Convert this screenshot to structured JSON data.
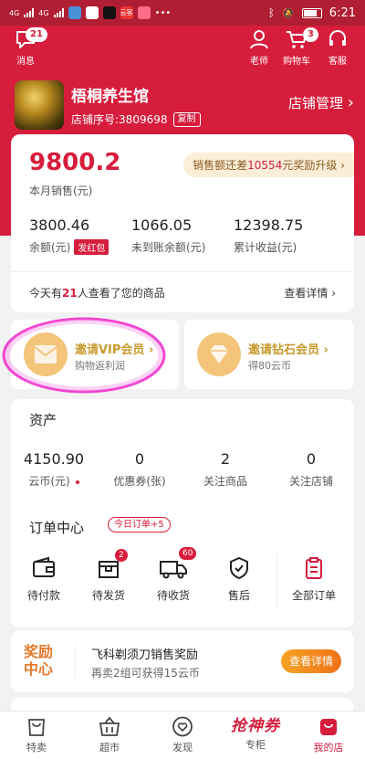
{
  "status_bar": {
    "network_1": "4G",
    "network_2": "4G",
    "app_badge": "云客",
    "time": "6:21"
  },
  "header": {
    "messages": {
      "label": "消息",
      "badge": "21"
    },
    "teacher": {
      "label": "老师"
    },
    "cart": {
      "label": "购物车",
      "badge": "3"
    },
    "service": {
      "label": "客服"
    },
    "store": {
      "name": "梧桐养生馆",
      "number": "店铺序号:3809698",
      "copy_label": "复制"
    },
    "manage_label": "店铺管理",
    "manage_chevron": "›"
  },
  "sales": {
    "monthly_value": "9800.2",
    "monthly_label": "本月销售(元)",
    "upgrade_prefix": "销售额还差",
    "upgrade_amount": "10554",
    "upgrade_suffix": "元奖励升级",
    "upgrade_chevron": "›",
    "stats": [
      {
        "value": "3800.46",
        "label": "余额(元)",
        "tag": "发红包"
      },
      {
        "value": "1066.05",
        "label": "未到账余额(元)"
      },
      {
        "value": "12398.75",
        "label": "累计收益(元)"
      }
    ],
    "viewed_prefix": "今天有",
    "viewed_count": "21",
    "viewed_suffix": "人查看了您的商品",
    "detail_label": "查看详情",
    "detail_chevron": "›"
  },
  "invites": {
    "vip": {
      "title": "邀请VIP会员",
      "subtitle": "购物返利润",
      "chevron": "›"
    },
    "diamond": {
      "title": "邀请钻石会员",
      "subtitle": "得80云币",
      "chevron": "›"
    }
  },
  "assets": {
    "title": "资产",
    "items": [
      {
        "value": "4150.90",
        "label": "云币(元)"
      },
      {
        "value": "0",
        "label": "优惠券(张)"
      },
      {
        "value": "2",
        "label": "关注商品"
      },
      {
        "value": "0",
        "label": "关注店铺"
      }
    ]
  },
  "orders": {
    "title": "订单中心",
    "today_badge": "今日订单+5",
    "items": [
      {
        "label": "待付款",
        "icon": "wallet-icon"
      },
      {
        "label": "待发货",
        "icon": "package-icon",
        "badge": "2"
      },
      {
        "label": "待收货",
        "icon": "truck-icon",
        "badge": "60"
      },
      {
        "label": "售后",
        "icon": "shield-icon"
      },
      {
        "label": "全部订单",
        "icon": "clipboard-icon"
      }
    ]
  },
  "reward": {
    "tag_line1": "奖励",
    "tag_line2": "中心",
    "title": "飞科剃须刀销售奖励",
    "subtitle": "再卖2组可获得15云币",
    "button_label": "查看详情"
  },
  "tabbar": {
    "items": [
      {
        "label": "特卖",
        "icon": "bag-icon"
      },
      {
        "label": "超市",
        "icon": "basket-icon"
      },
      {
        "label": "发现",
        "icon": "heart-circle-icon"
      },
      {
        "label": "专柜",
        "brand_text": "抢神券"
      },
      {
        "label": "我的店",
        "icon": "store-icon",
        "active": true
      }
    ]
  },
  "colors": {
    "brand_red": "#d61d3c",
    "gold": "#c89a2c",
    "orange": "#f07218"
  }
}
